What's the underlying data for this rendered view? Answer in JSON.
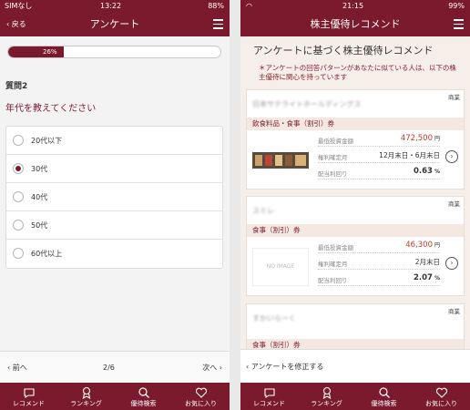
{
  "colors": {
    "brand": "#7a1a2c",
    "accent_red": "#c0392b"
  },
  "left": {
    "status": {
      "carrier": "SIMなし",
      "time": "13:22",
      "battery": "88%"
    },
    "nav": {
      "back": "‹ 戻る",
      "title": "アンケート"
    },
    "progress": {
      "value": 0.26,
      "label": "26%"
    },
    "question_number": "質問2",
    "question_text": "年代を教えてください",
    "options": [
      {
        "label": "20代以下",
        "selected": false
      },
      {
        "label": "30代",
        "selected": true
      },
      {
        "label": "40代",
        "selected": false
      },
      {
        "label": "50代",
        "selected": false
      },
      {
        "label": "60代以上",
        "selected": false
      }
    ],
    "pager": {
      "prev": "‹ 前へ",
      "page": "2/6",
      "next": "次へ ›"
    }
  },
  "right": {
    "status": {
      "time": "21:15",
      "battery": "99%"
    },
    "nav": {
      "title": "株主優待レコメンド"
    },
    "heading": "アンケートに基づく株主優待レコメンド",
    "note": "＊アンケートの回答パターンがあなたに似ている人は、以下の株主優待に関心を持っています",
    "cards": [
      {
        "category": "商業",
        "company_blurred": "日本サテライトホールディングス",
        "benefit": "飲食料品・食事（割引）券",
        "labels": {
          "min_invest": "最低投資金額",
          "rights_month": "権利確定月",
          "yield": "配当利回り"
        },
        "min_invest": "472,500",
        "min_invest_unit": "円",
        "rights_month": "12月末日・6月末日",
        "yield": "0.63",
        "yield_unit": "%"
      },
      {
        "category": "商業",
        "company_blurred": "スミレ",
        "benefit": "食事（割引）券",
        "labels": {
          "min_invest": "最低投資金額",
          "rights_month": "権利確定月",
          "yield": "配当利回り"
        },
        "min_invest": "46,300",
        "min_invest_unit": "円",
        "rights_month": "2月末日",
        "yield": "2.07",
        "yield_unit": "%",
        "image_placeholder": "NO IMAGE"
      },
      {
        "category": "商業",
        "company_blurred": "すかいらーく",
        "benefit": "食事（割引）券"
      }
    ],
    "bottom_link": "‹ アンケートを修正する"
  },
  "tabs": [
    {
      "label": "レコメンド",
      "icon": "recommend-icon"
    },
    {
      "label": "ランキング",
      "icon": "ranking-icon"
    },
    {
      "label": "優待検索",
      "icon": "search-icon"
    },
    {
      "label": "お気に入り",
      "icon": "heart-icon"
    }
  ]
}
